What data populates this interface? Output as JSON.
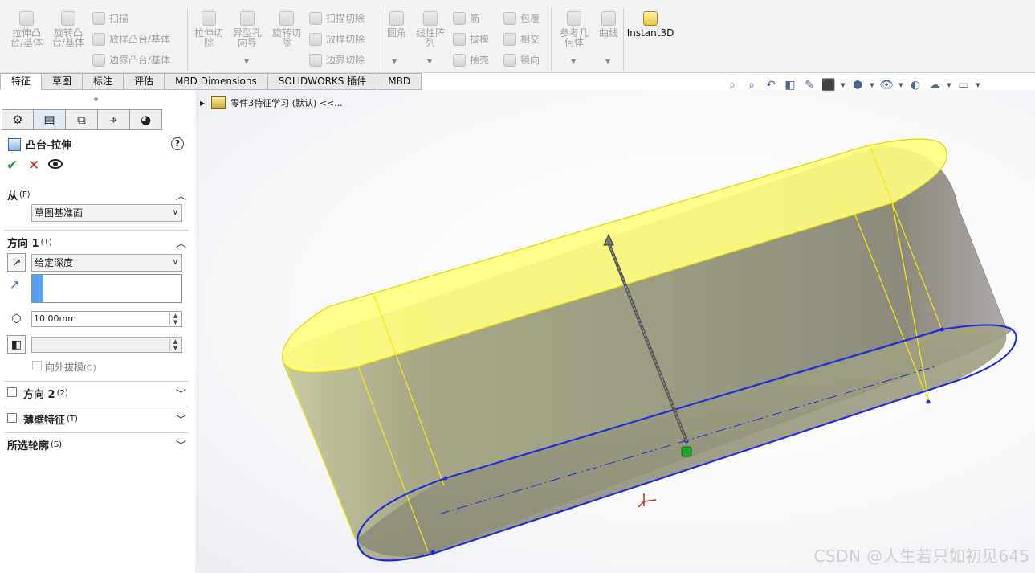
{
  "ribbon": {
    "extrude_boss": "拉伸凸\n台/基体",
    "revolve_boss": "旋转凸\n台/基体",
    "sweep": "扫描",
    "loft_boss": "放样凸台/基体",
    "boundary_boss": "边界凸台/基体",
    "extrude_cut": "拉伸切\n除",
    "hole_wizard": "异型孔\n向导",
    "revolve_cut": "旋转切\n除",
    "swept_cut": "扫描切除",
    "lofted_cut": "放样切除",
    "boundary_cut": "边界切除",
    "fillet": "圆角",
    "linear_pattern": "线性阵\n列",
    "rib": "筋",
    "draft": "拔模",
    "shell": "抽壳",
    "wrap": "包覆",
    "intersect": "相交",
    "mirror": "镜向",
    "reference_geometry": "参考几\n何体",
    "curves": "曲线",
    "instant3d": "Instant3D"
  },
  "tabs": [
    "特征",
    "草图",
    "标注",
    "评估",
    "MBD Dimensions",
    "SOLIDWORKS 插件",
    "MBD"
  ],
  "panel": {
    "title": "凸台-拉伸",
    "from": {
      "label": "从",
      "accel": "(F)",
      "value": "草图基准面"
    },
    "direction1": {
      "label": "方向 1",
      "accel": "(1)",
      "end_condition": "给定深度",
      "depth": "10.00mm",
      "draft_outward": "向外拔模",
      "draft_accel": "(O)"
    },
    "direction2": {
      "label": "方向 2",
      "accel": "(2)"
    },
    "thin_feature": {
      "label": "薄壁特征",
      "accel": "(T)"
    },
    "selected_contours": {
      "label": "所选轮廓",
      "accel": "(S)"
    }
  },
  "tree": {
    "root": "零件3特征学习  (默认) <<..."
  },
  "watermark": "CSDN @人生若只如初见645",
  "colors": {
    "top_face": "#ffff80",
    "body": "#a8a88a",
    "sketch": "#1f2fd8",
    "accent": "#5aa0f0"
  }
}
